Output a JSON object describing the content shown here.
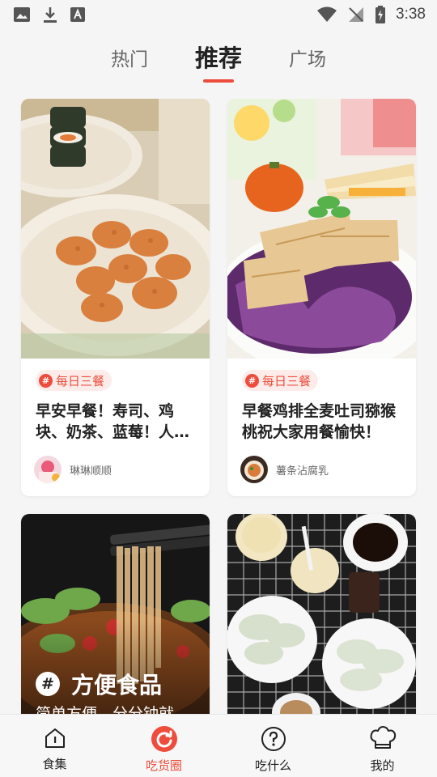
{
  "status_bar": {
    "time": "3:38"
  },
  "tabs": [
    {
      "label": "热门"
    },
    {
      "label": "推荐"
    },
    {
      "label": "广场"
    }
  ],
  "active_tab": "推荐",
  "cards": [
    {
      "tag": "每日三餐",
      "title": "早安早餐！寿司、鸡块、奶茶、蓝莓！人…",
      "author": "琳琳顺顺"
    },
    {
      "tag": "每日三餐",
      "title": "早餐鸡排全麦吐司猕猴桃祝大家用餐愉快！",
      "author": "薯条沾腐乳"
    },
    {
      "overlay_title": "方便食品",
      "overlay_subtitle": "简单方便，分分钟就…"
    },
    {}
  ],
  "bottom_nav": [
    {
      "label": "食集",
      "icon": "home-icon"
    },
    {
      "label": "吃货圈",
      "icon": "refresh-icon"
    },
    {
      "label": "吃什么",
      "icon": "question-icon"
    },
    {
      "label": "我的",
      "icon": "chef-hat-icon"
    }
  ],
  "active_nav": "吃货圈",
  "colors": {
    "accent": "#ee4d3d",
    "background": "#f5f5f5",
    "tag_bg": "#fdecea"
  }
}
